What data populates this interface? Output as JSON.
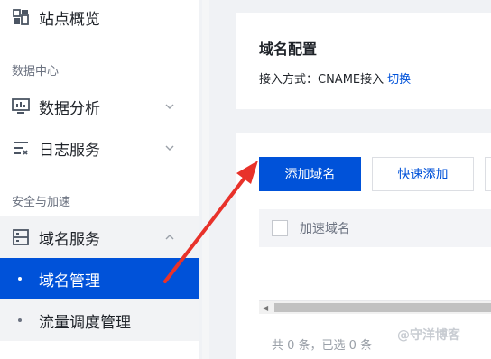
{
  "sidebar": {
    "overview": {
      "label": "站点概览",
      "icon": "dashboard-icon"
    },
    "section_data": "数据中心",
    "data_analysis": {
      "label": "数据分析",
      "icon": "monitor-icon"
    },
    "log_service": {
      "label": "日志服务",
      "icon": "log-list-icon"
    },
    "section_security": "安全与加速",
    "domain_service": {
      "label": "域名服务",
      "icon": "server-icon",
      "expanded": true
    },
    "sub_items": [
      {
        "label": "域名管理",
        "active": true
      },
      {
        "label": "流量调度管理",
        "active": false
      }
    ]
  },
  "config_card": {
    "title": "域名配置",
    "access_label": "接入方式：CNAME接入",
    "switch_label": "切换"
  },
  "table_card": {
    "add_button": "添加域名",
    "quick_add_button": "快速添加",
    "column_domain": "加速域名",
    "footer": "共 0 条，已选 0 条"
  },
  "watermark": "@守洋博客",
  "colors": {
    "accent": "#0052d9",
    "arrow": "#e8322a"
  }
}
